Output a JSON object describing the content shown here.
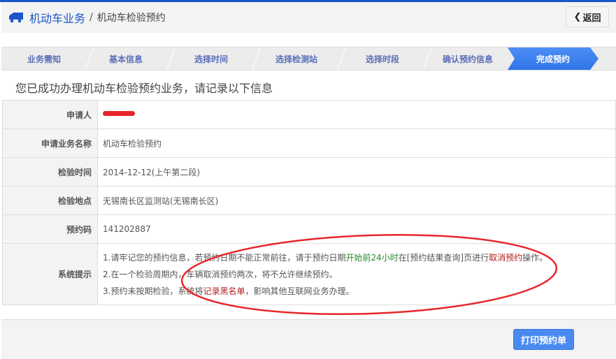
{
  "header": {
    "breadcrumb_root": "机动车业务",
    "separator": "/",
    "breadcrumb_current": "机动车检验预约",
    "back_label": "返回",
    "icon": "truck-icon"
  },
  "steps": [
    "业务需知",
    "基本信息",
    "选择时间",
    "选择检测站",
    "选择时段",
    "确认预约信息",
    "完成预约"
  ],
  "active_step": "完成预约",
  "success_message": "您已成功办理机动车检验预约业务，请记录以下信息",
  "info": {
    "applicant_label": "申请人",
    "applicant_value": "(redacted)",
    "business_label": "申请业务名称",
    "business_value": "机动车检验预约",
    "time_label": "检验时间",
    "time_value": "2014-12-12(上午第二段)",
    "place_label": "检验地点",
    "place_value": "无锡南长区监测站(无锡南长区)",
    "code_label": "预约码",
    "code_value": "141202887",
    "tips_label": "系统提示"
  },
  "tips": {
    "t1a": "1.请牢记您的预约信息，若预约日期不能正常前往，请于预约日期",
    "t1b": "开始前24小时",
    "t1c": "在[预约结果查询]页进行",
    "t1d": "取消预约",
    "t1e": "操作。",
    "t2": "2.在一个检验周期内，车辆取消预约两次，将不允许继续预约。",
    "t3a": "3.预约未按期检验，系统将",
    "t3b": "记录黑名单",
    "t3c": "，影响其他互联网业务办理。"
  },
  "print_label": "打印预约单",
  "colors": {
    "brand": "#1a56c8",
    "active_step": "#3a7ff0",
    "green": "#2a8a2a",
    "red": "#b02020",
    "annotation": "#e8262a"
  }
}
